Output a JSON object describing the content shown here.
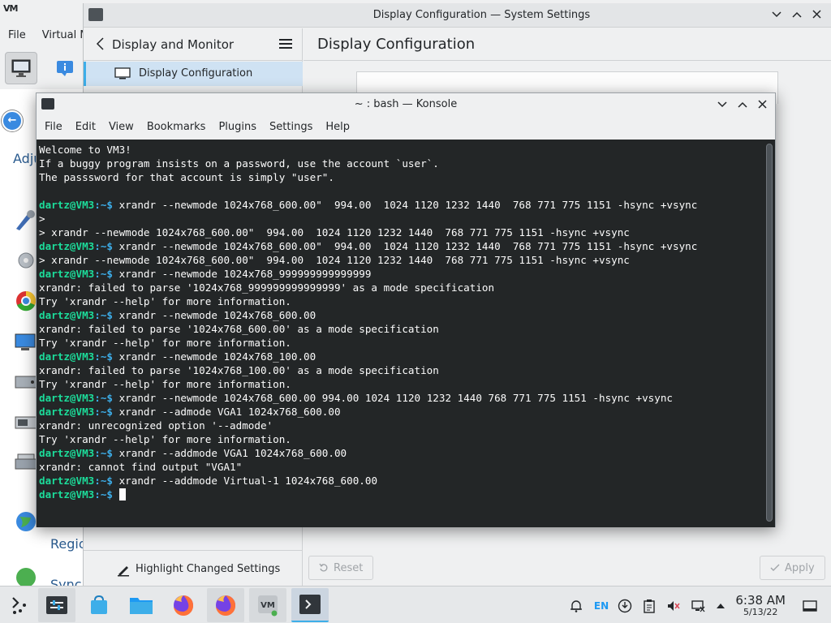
{
  "vm_window": {
    "logo": "VM",
    "menu": [
      "File",
      "Virtual M"
    ],
    "left_partial_text": "Adju",
    "left_items": [
      "Regio",
      "Sync"
    ]
  },
  "system_settings": {
    "title": "Display Configuration — System Settings",
    "sidebar_title": "Display and Monitor",
    "sidebar_items": [
      "Display Configuration"
    ],
    "content_title": "Display Configuration",
    "highlight_label": "Highlight Changed Settings",
    "reset_label": "Reset",
    "apply_label": "Apply"
  },
  "konsole": {
    "title": "~ : bash — Konsole",
    "menu": [
      "File",
      "Edit",
      "View",
      "Bookmarks",
      "Plugins",
      "Settings",
      "Help"
    ],
    "prompt_user": "dartz@VM3",
    "prompt_path": ":~$ ",
    "lines": [
      {
        "t": "Welcome to VM3!"
      },
      {
        "t": "If a buggy program insists on a password, use the account `user`."
      },
      {
        "t": "The passsword for that account is simply \"user\"."
      },
      {
        "t": ""
      },
      {
        "p": true,
        "t": "xrandr --newmode 1024x768_600.00\"  994.00  1024 1120 1232 1440  768 771 775 1151 -hsync +vsync"
      },
      {
        "t": ">"
      },
      {
        "t": "> xrandr --newmode 1024x768_600.00\"  994.00  1024 1120 1232 1440  768 771 775 1151 -hsync +vsync"
      },
      {
        "p": true,
        "t": "xrandr --newmode 1024x768_600.00\"  994.00  1024 1120 1232 1440  768 771 775 1151 -hsync +vsync"
      },
      {
        "t": "> xrandr --newmode 1024x768_600.00\"  994.00  1024 1120 1232 1440  768 771 775 1151 -hsync +vsync"
      },
      {
        "p": true,
        "t": "xrandr --newmode 1024x768_999999999999999"
      },
      {
        "t": "xrandr: failed to parse '1024x768_999999999999999' as a mode specification"
      },
      {
        "t": "Try 'xrandr --help' for more information."
      },
      {
        "p": true,
        "t": "xrandr --newmode 1024x768_600.00"
      },
      {
        "t": "xrandr: failed to parse '1024x768_600.00' as a mode specification"
      },
      {
        "t": "Try 'xrandr --help' for more information."
      },
      {
        "p": true,
        "t": "xrandr --newmode 1024x768_100.00"
      },
      {
        "t": "xrandr: failed to parse '1024x768_100.00' as a mode specification"
      },
      {
        "t": "Try 'xrandr --help' for more information."
      },
      {
        "p": true,
        "t": "xrandr --newmode 1024x768_600.00 994.00 1024 1120 1232 1440 768 771 775 1151 -hsync +vsync"
      },
      {
        "p": true,
        "t": "xrandr --admode VGA1 1024x768_600.00"
      },
      {
        "t": "xrandr: unrecognized option '--admode'"
      },
      {
        "t": "Try 'xrandr --help' for more information."
      },
      {
        "p": true,
        "t": "xrandr --addmode VGA1 1024x768_600.00"
      },
      {
        "t": "xrandr: cannot find output \"VGA1\""
      },
      {
        "p": true,
        "t": "xrandr --addmode Virtual-1 1024x768_600.00"
      },
      {
        "p": true,
        "t": "",
        "cursor": true
      }
    ]
  },
  "taskbar": {
    "tray_lang": "EN",
    "time": "6:38 AM",
    "date": "5/13/22"
  },
  "colors": {
    "terminal_bg": "#232627",
    "prompt_user": "#1cdc9a",
    "prompt_path": "#3daee9",
    "accent": "#3daee9"
  }
}
